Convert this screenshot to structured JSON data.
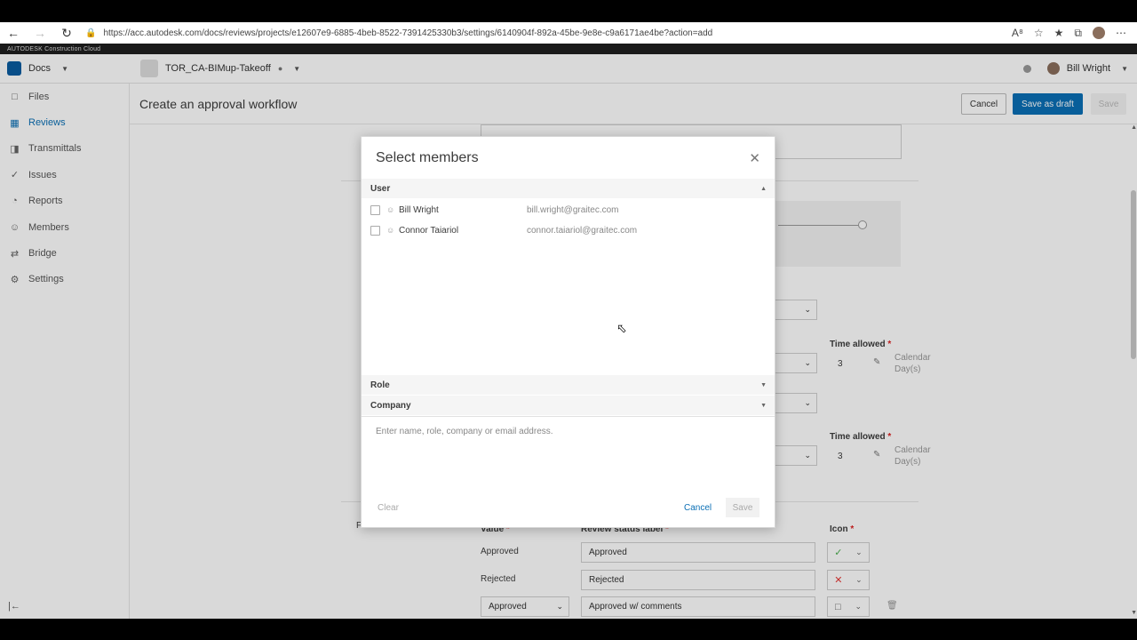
{
  "browser": {
    "url": "https://acc.autodesk.com/docs/reviews/projects/e12607e9-6885-4beb-8522-7391425330b3/settings/6140904f-892a-45be-9e8e-c9a6171ae4be?action=add"
  },
  "brand": {
    "label": "AUTODESK Construction Cloud"
  },
  "header": {
    "module": "Docs",
    "project": "TOR_CA-BIMup-Takeoff",
    "user": "Bill Wright"
  },
  "sidebar": {
    "items": [
      {
        "label": "Files",
        "icon": "file-icon"
      },
      {
        "label": "Reviews",
        "icon": "reviews-icon",
        "active": true
      },
      {
        "label": "Transmittals",
        "icon": "transmittals-icon"
      },
      {
        "label": "Issues",
        "icon": "issues-icon"
      },
      {
        "label": "Reports",
        "icon": "reports-icon"
      },
      {
        "label": "Members",
        "icon": "members-icon"
      },
      {
        "label": "Bridge",
        "icon": "bridge-icon"
      },
      {
        "label": "Settings",
        "icon": "settings-icon"
      }
    ]
  },
  "page": {
    "title": "Create an approval workflow",
    "cancel_label": "Cancel",
    "draft_label": "Save as draft",
    "save_label": "Save"
  },
  "background": {
    "time_allowed_label": "Time allowed",
    "required_mark": "*",
    "time_value": "3",
    "calendar_label": "Calendar Day(s)",
    "status_section_label": "Final review status",
    "value_header": "Value",
    "status_label_header": "Review status label",
    "icon_header": "Icon",
    "rows": [
      {
        "value": "Approved",
        "label": "Approved"
      },
      {
        "value": "Rejected",
        "label": "Rejected"
      },
      {
        "value": "Approved",
        "label": "Approved w/ comments"
      }
    ]
  },
  "modal": {
    "title": "Select members",
    "sections": {
      "user": "User",
      "role": "Role",
      "company": "Company"
    },
    "members": [
      {
        "name": "Bill Wright",
        "email": "bill.wright@graitec.com"
      },
      {
        "name": "Connor Taiariol",
        "email": "connor.taiariol@graitec.com"
      }
    ],
    "search_placeholder": "Enter name, role, company or email address.",
    "clear_label": "Clear",
    "cancel_label": "Cancel",
    "save_label": "Save"
  },
  "colors": {
    "accent": "#0a6fb5",
    "approved_icon": "#4caf50",
    "rejected_icon": "#e53935"
  }
}
